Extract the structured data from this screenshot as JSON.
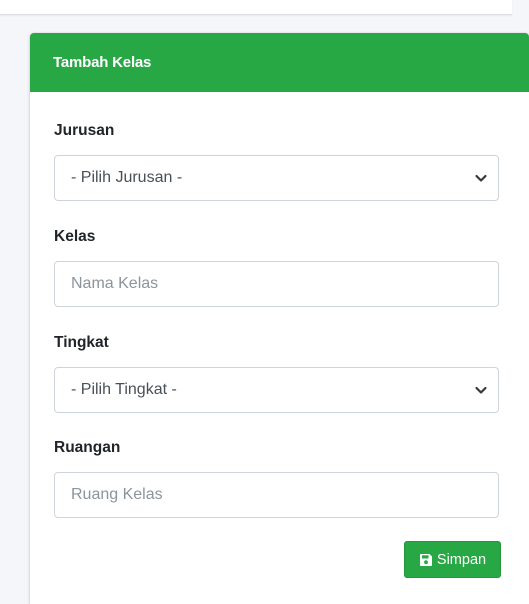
{
  "card": {
    "title": "Tambah Kelas"
  },
  "form": {
    "jurusan": {
      "label": "Jurusan",
      "selected": "- Pilih Jurusan -"
    },
    "kelas": {
      "label": "Kelas",
      "placeholder": "Nama Kelas"
    },
    "tingkat": {
      "label": "Tingkat",
      "selected": "- Pilih Tingkat -"
    },
    "ruangan": {
      "label": "Ruangan",
      "placeholder": "Ruang Kelas"
    }
  },
  "actions": {
    "save_label": "Simpan",
    "save_icon": "save-icon"
  },
  "colors": {
    "header_bg": "#28a745",
    "button_bg": "#28a745",
    "page_bg": "#f4f6f9"
  }
}
